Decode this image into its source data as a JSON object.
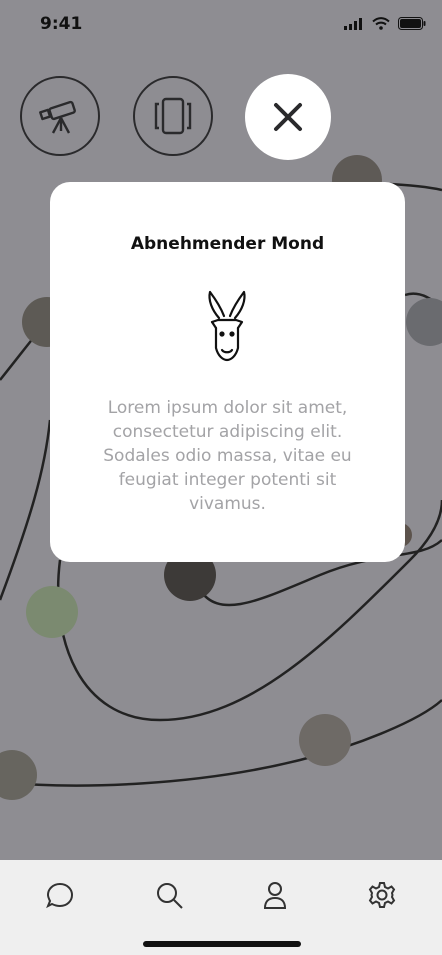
{
  "status_bar": {
    "time": "9:41"
  },
  "top_actions": {
    "telescope": "telescope-icon",
    "carousel": "carousel-icon",
    "close": "close-icon"
  },
  "modal": {
    "title": "Abnehmender Mond",
    "icon": "capricorn-goat-icon",
    "description": "Lorem ipsum dolor sit amet, consectetur adipiscing elit. Sodales odio massa, vitae eu feugiat integer potenti sit vivamus."
  },
  "tab_bar": {
    "items": [
      "chat-icon",
      "search-icon",
      "profile-icon",
      "settings-icon"
    ]
  },
  "colors": {
    "overlay": "#8e8d92",
    "modal_bg": "#ffffff",
    "tab_bar_bg": "#efefef"
  }
}
